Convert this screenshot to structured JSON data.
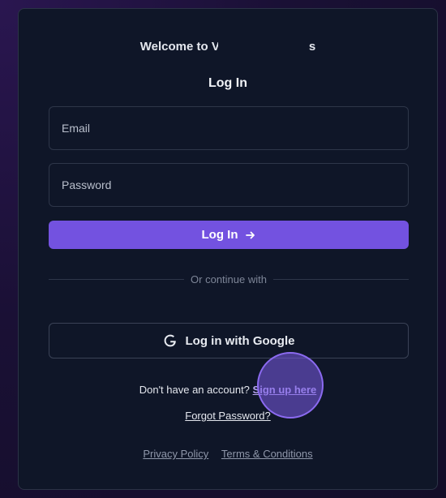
{
  "welcome": {
    "text": "Welcome to V",
    "suffix": "s"
  },
  "login": {
    "title": "Log In",
    "email_placeholder": "Email",
    "password_placeholder": "Password",
    "submit_label": "Log In",
    "submit_icon": "arrow-right-icon"
  },
  "divider": {
    "text": "Or continue with"
  },
  "google": {
    "label": "Log in with Google",
    "icon": "google-icon"
  },
  "signup": {
    "prompt": "Don't have an account?",
    "link": "Sign up here"
  },
  "forgot": {
    "link": "Forgot Password?"
  },
  "footer": {
    "privacy": "Privacy Policy",
    "terms": "Terms & Conditions"
  },
  "colors": {
    "accent": "#7352e0",
    "card_bg": "#0f1628",
    "highlight": "#8b6af0"
  }
}
